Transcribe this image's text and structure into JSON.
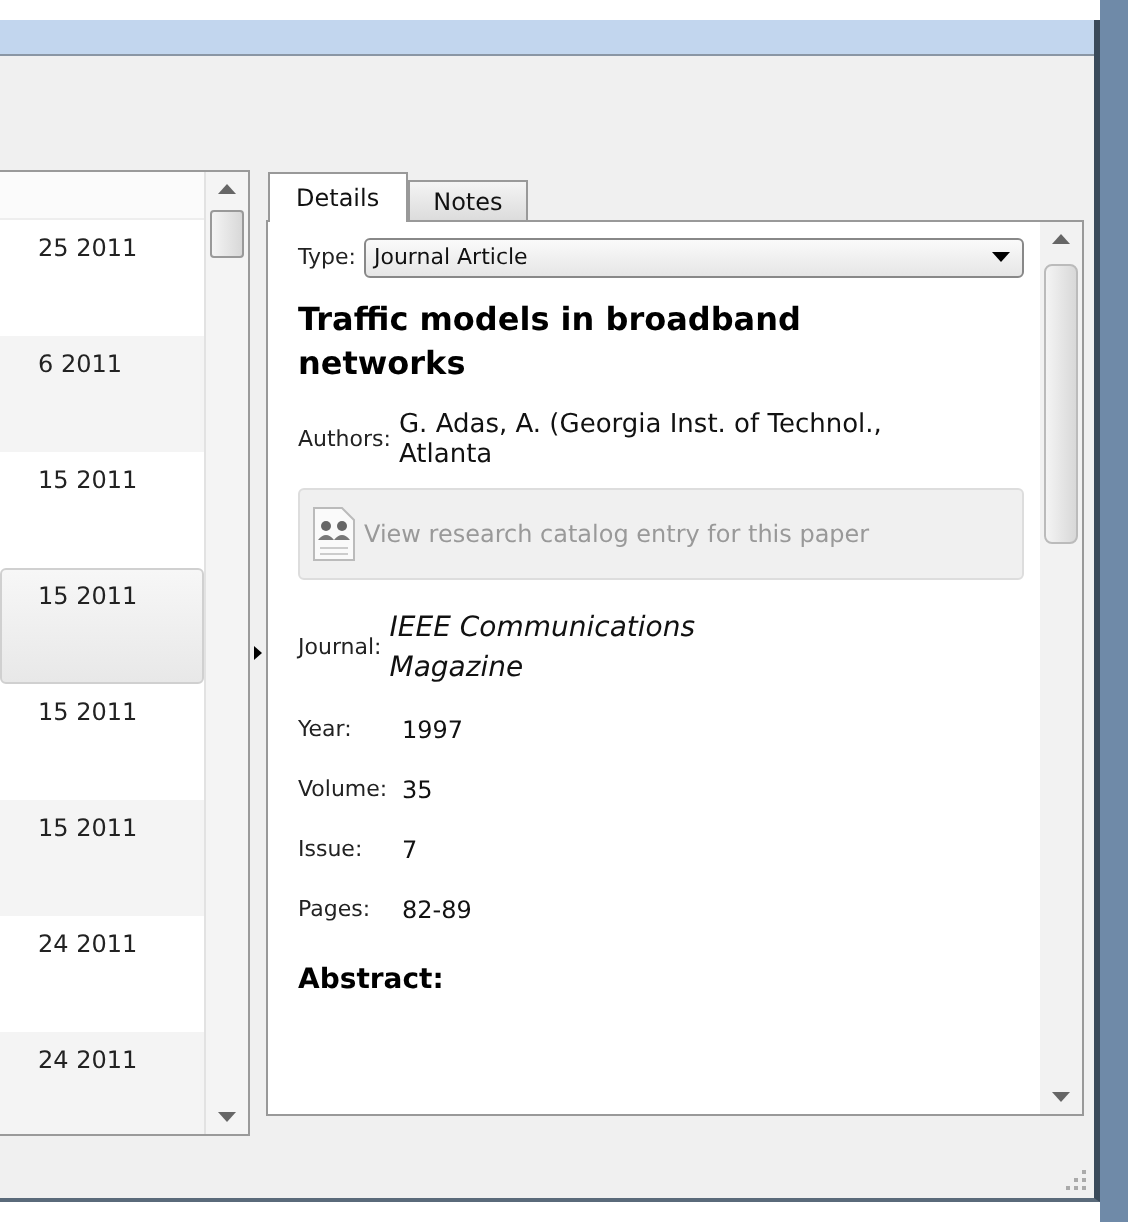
{
  "list": {
    "rows": [
      {
        "date": "25 2011",
        "selected": false
      },
      {
        "date": "6 2011",
        "selected": false
      },
      {
        "date": "15 2011",
        "selected": false
      },
      {
        "date": "15 2011",
        "selected": true
      },
      {
        "date": "15 2011",
        "selected": false
      },
      {
        "date": "15 2011",
        "selected": false
      },
      {
        "date": "24 2011",
        "selected": false
      },
      {
        "date": "24 2011",
        "selected": false
      }
    ]
  },
  "tabs": [
    {
      "label": "Details",
      "selected": true
    },
    {
      "label": "Notes",
      "selected": false
    }
  ],
  "details": {
    "type_label": "Type:",
    "type_value": "Journal Article",
    "title": "Traffic models in broadband networks",
    "authors_label": "Authors:",
    "authors": "G. Adas, A. (Georgia Inst. of Technol., Atlanta",
    "catalog_button": {
      "label": "View research catalog entry for this paper",
      "disabled": true
    },
    "journal_label": "Journal:",
    "journal": "IEEE Communications Magazine",
    "fields": [
      {
        "label": "Year:",
        "value": "1997"
      },
      {
        "label": "Volume:",
        "value": "35"
      },
      {
        "label": "Issue:",
        "value": "7"
      },
      {
        "label": "Pages:",
        "value": "82-89"
      }
    ],
    "abstract_heading": "Abstract:"
  }
}
